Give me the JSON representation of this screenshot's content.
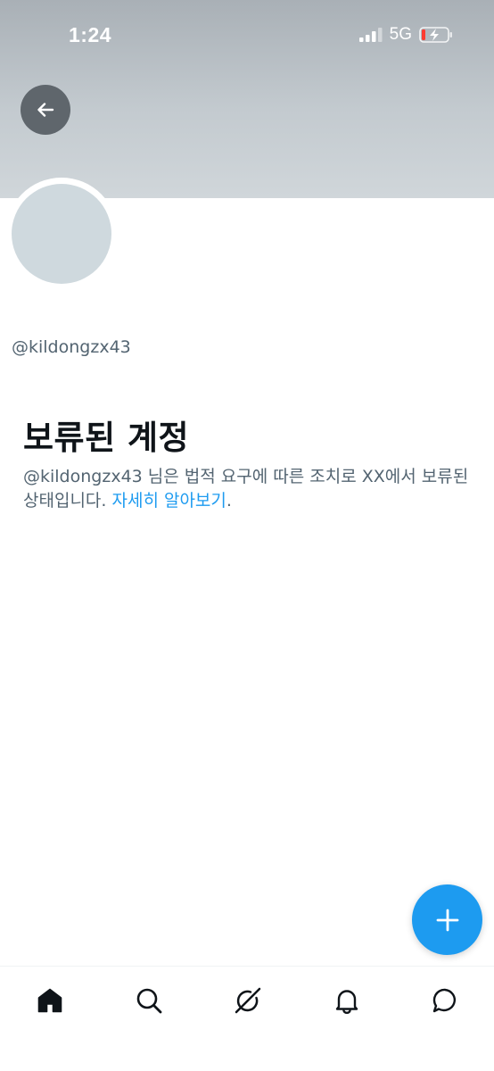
{
  "status_bar": {
    "time": "1:24",
    "network": "5G",
    "signal_icon": "signal-bars-icon",
    "battery_icon": "battery-charging-icon"
  },
  "header": {
    "back_icon": "arrow-left-icon"
  },
  "profile": {
    "handle": "@kildongzx43"
  },
  "suspended": {
    "title": "보류된 계정",
    "message": "@kildongzx43 님은 법적 요구에 따른 조치로 XX에서 보류된 상태입니다. ",
    "learn_more": "자세히 알아보기",
    "suffix": "."
  },
  "fab": {
    "icon": "plus-icon"
  },
  "bottom_nav": {
    "items": [
      {
        "icon": "home-icon",
        "active": true
      },
      {
        "icon": "search-icon",
        "active": false
      },
      {
        "icon": "grok-icon",
        "active": false
      },
      {
        "icon": "bell-icon",
        "active": false
      },
      {
        "icon": "messages-icon",
        "active": false
      }
    ]
  },
  "colors": {
    "accent": "#1d9bf0",
    "text_primary": "#0f1419",
    "text_secondary": "#536471",
    "avatar_placeholder": "#cfd9de"
  }
}
